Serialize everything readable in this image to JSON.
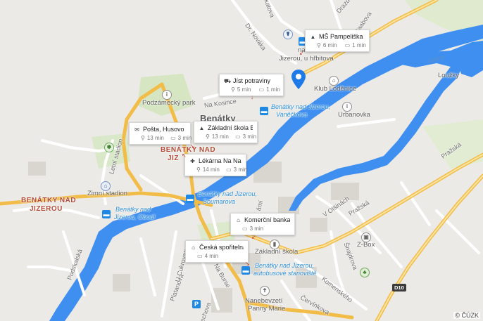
{
  "colors": {
    "land": "#eceae6",
    "water": "#3f8ff0",
    "main_road": "#f6c453",
    "minor_road": "#ffffff",
    "green": "#cfe3b9",
    "pin": "#1e7ae6"
  },
  "streets": {
    "dr_novaka": "Dr. Nováka",
    "na_kosince": "Na Kosince",
    "letni_stadion": "Letní stadion",
    "podskalska": "Podskalská",
    "prazska_1": "Pražská",
    "prazska_2": "Pražská",
    "v_olsinach": "V Olšinách",
    "snajdrova": "Šnajdrova",
    "komenskeho": "Komenského",
    "cervinkova": "Červínkova",
    "platanova": "Platanová",
    "na_burse": "Na Burse",
    "u_cukrovaru": "U Cukrovaru",
    "raabova": "Raabova",
    "jizerska_top": "Jizerka",
    "nami": "ámí",
    "drazd": "Drazd",
    "pakatova": "lakatova",
    "rechova": "echova"
  },
  "places": {
    "benatky": "Benátky",
    "benatky_red": "BENÁTKY NAD",
    "benatky_red2": "JIZ",
    "benatky_nad_jizerou_1": "BENÁTKY NAD",
    "benatky_nad_jizerou_2": "JIZEROU"
  },
  "pois": {
    "podzamecky_park": "Podzámecký park",
    "zimni_stadion": "Zimní stadion",
    "klub_lodenice": "Klub Loděnice",
    "urbanovka": "Urbanovka",
    "zakladni_skola": "Základní škola",
    "z_box": "Z-Box",
    "nanebevzeti_1": "Nanebevzetí",
    "nanebevzeti_2": "Panny Marie",
    "louzky": "Loužky",
    "jizera_water": "Jizera",
    "ndraz_hrbitova": "Jizerou, u hřbitova",
    "nad_hrbitova_2": "nad"
  },
  "stops": {
    "vaneckova_1": "Benátky nad Jizerou,",
    "vaneckova_2": "Vaněčkova",
    "soumarova_1": "Benátky nad Jizerou,",
    "soumarova_2": "Soumarova",
    "obodi_1": "Benátky nad",
    "obodi_2": "Jizerou, Obodí",
    "autobus_1": "Benátky nad Jizerou,",
    "autobus_2": "autobusové stanoviště"
  },
  "road_numbers": {
    "d10": "D10"
  },
  "cards": [
    {
      "id": "ms-pampeliska",
      "icon": "school-icon",
      "title": "MŠ Pampeliška",
      "walk": "6 min",
      "car": "1 min"
    },
    {
      "id": "jist-potraviny",
      "icon": "cart-icon",
      "title": "Jíst potraviny",
      "walk": "5 min",
      "car": "1 min"
    },
    {
      "id": "posta",
      "icon": "post-icon",
      "title": "Pošta, Husovo ná...",
      "walk": "13 min",
      "car": "3 min"
    },
    {
      "id": "zakladni-skola",
      "icon": "school-icon",
      "title": "Základní škola Be...",
      "walk": "13 min",
      "car": "3 min"
    },
    {
      "id": "lekarna",
      "icon": "pharmacy-icon",
      "title": "Lékárna Na Nam...",
      "walk": "14 min",
      "car": "3 min"
    },
    {
      "id": "komercni-banka",
      "icon": "bank-icon",
      "title": "Komerční banka",
      "walk": "",
      "car": "3 min"
    },
    {
      "id": "ceska-sporitelna",
      "icon": "bank-icon",
      "title": "Česká spořitelna",
      "walk": "",
      "car": "4 min"
    }
  ],
  "copyright": "© ČÚZK"
}
